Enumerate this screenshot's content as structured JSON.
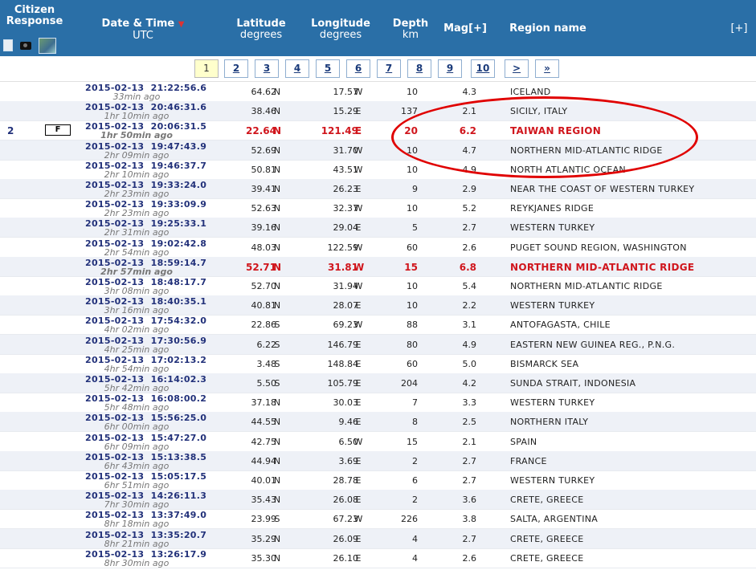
{
  "header": {
    "citizen_response": "Citizen Response",
    "date_time": "Date & Time",
    "date_time_unit": "UTC",
    "latitude": "Latitude",
    "latitude_unit": "degrees",
    "longitude": "Longitude",
    "longitude_unit": "degrees",
    "depth": "Depth",
    "depth_unit": "km",
    "mag": "Mag[+]",
    "region": "Region name",
    "expand": "[+]",
    "sort_indicator": "▼"
  },
  "pager": [
    "1",
    "2",
    "3",
    "4",
    "5",
    "6",
    "7",
    "8",
    "9",
    "10",
    ">",
    "»"
  ],
  "rows": [
    {
      "resp": "",
      "flag": "",
      "date": "2015-02-13",
      "time": "21:22:56.6",
      "ago": "33min ago",
      "lat": "64.62",
      "ns": "N",
      "lon": "17.57",
      "ew": "W",
      "depth": "10",
      "mag": "4.3",
      "region": "ICELAND",
      "hl": false
    },
    {
      "resp": "",
      "flag": "",
      "date": "2015-02-13",
      "time": "20:46:31.6",
      "ago": "1hr 10min ago",
      "lat": "38.46",
      "ns": "N",
      "lon": "15.29",
      "ew": "E",
      "depth": "137",
      "mag": "2.1",
      "region": "SICILY, ITALY",
      "hl": false
    },
    {
      "resp": "2",
      "flag": "F",
      "date": "2015-02-13",
      "time": "20:06:31.5",
      "ago": "1hr 50min ago",
      "lat": "22.64",
      "ns": "N",
      "lon": "121.49",
      "ew": "E",
      "depth": "20",
      "mag": "6.2",
      "region": "TAIWAN REGION",
      "hl": true
    },
    {
      "resp": "",
      "flag": "",
      "date": "2015-02-13",
      "time": "19:47:43.9",
      "ago": "2hr 09min ago",
      "lat": "52.69",
      "ns": "N",
      "lon": "31.70",
      "ew": "W",
      "depth": "10",
      "mag": "4.7",
      "region": "NORTHERN MID-ATLANTIC RIDGE",
      "hl": false
    },
    {
      "resp": "",
      "flag": "",
      "date": "2015-02-13",
      "time": "19:46:37.7",
      "ago": "2hr 10min ago",
      "lat": "50.81",
      "ns": "N",
      "lon": "43.51",
      "ew": "W",
      "depth": "10",
      "mag": "4.9",
      "region": "NORTH ATLANTIC OCEAN",
      "hl": false
    },
    {
      "resp": "",
      "flag": "",
      "date": "2015-02-13",
      "time": "19:33:24.0",
      "ago": "2hr 23min ago",
      "lat": "39.41",
      "ns": "N",
      "lon": "26.23",
      "ew": "E",
      "depth": "9",
      "mag": "2.9",
      "region": "NEAR THE COAST OF WESTERN TURKEY",
      "hl": false
    },
    {
      "resp": "",
      "flag": "",
      "date": "2015-02-13",
      "time": "19:33:09.9",
      "ago": "2hr 23min ago",
      "lat": "52.63",
      "ns": "N",
      "lon": "32.37",
      "ew": "W",
      "depth": "10",
      "mag": "5.2",
      "region": "REYKJANES RIDGE",
      "hl": false
    },
    {
      "resp": "",
      "flag": "",
      "date": "2015-02-13",
      "time": "19:25:33.1",
      "ago": "2hr 31min ago",
      "lat": "39.16",
      "ns": "N",
      "lon": "29.04",
      "ew": "E",
      "depth": "5",
      "mag": "2.7",
      "region": "WESTERN TURKEY",
      "hl": false
    },
    {
      "resp": "",
      "flag": "",
      "date": "2015-02-13",
      "time": "19:02:42.8",
      "ago": "2hr 54min ago",
      "lat": "48.03",
      "ns": "N",
      "lon": "122.59",
      "ew": "W",
      "depth": "60",
      "mag": "2.6",
      "region": "PUGET SOUND REGION, WASHINGTON",
      "hl": false
    },
    {
      "resp": "",
      "flag": "",
      "date": "2015-02-13",
      "time": "18:59:14.7",
      "ago": "2hr 57min ago",
      "lat": "52.71",
      "ns": "N",
      "lon": "31.81",
      "ew": "W",
      "depth": "15",
      "mag": "6.8",
      "region": "NORTHERN MID-ATLANTIC RIDGE",
      "hl": true
    },
    {
      "resp": "",
      "flag": "",
      "date": "2015-02-13",
      "time": "18:48:17.7",
      "ago": "3hr 08min ago",
      "lat": "52.70",
      "ns": "N",
      "lon": "31.94",
      "ew": "W",
      "depth": "10",
      "mag": "5.4",
      "region": "NORTHERN MID-ATLANTIC RIDGE",
      "hl": false
    },
    {
      "resp": "",
      "flag": "",
      "date": "2015-02-13",
      "time": "18:40:35.1",
      "ago": "3hr 16min ago",
      "lat": "40.81",
      "ns": "N",
      "lon": "28.07",
      "ew": "E",
      "depth": "10",
      "mag": "2.2",
      "region": "WESTERN TURKEY",
      "hl": false
    },
    {
      "resp": "",
      "flag": "",
      "date": "2015-02-13",
      "time": "17:54:32.0",
      "ago": "4hr 02min ago",
      "lat": "22.86",
      "ns": "S",
      "lon": "69.23",
      "ew": "W",
      "depth": "88",
      "mag": "3.1",
      "region": "ANTOFAGASTA, CHILE",
      "hl": false
    },
    {
      "resp": "",
      "flag": "",
      "date": "2015-02-13",
      "time": "17:30:56.9",
      "ago": "4hr 25min ago",
      "lat": "6.22",
      "ns": "S",
      "lon": "146.79",
      "ew": "E",
      "depth": "80",
      "mag": "4.9",
      "region": "EASTERN NEW GUINEA REG., P.N.G.",
      "hl": false
    },
    {
      "resp": "",
      "flag": "",
      "date": "2015-02-13",
      "time": "17:02:13.2",
      "ago": "4hr 54min ago",
      "lat": "3.48",
      "ns": "S",
      "lon": "148.84",
      "ew": "E",
      "depth": "60",
      "mag": "5.0",
      "region": "BISMARCK SEA",
      "hl": false
    },
    {
      "resp": "",
      "flag": "",
      "date": "2015-02-13",
      "time": "16:14:02.3",
      "ago": "5hr 42min ago",
      "lat": "5.50",
      "ns": "S",
      "lon": "105.79",
      "ew": "E",
      "depth": "204",
      "mag": "4.2",
      "region": "SUNDA STRAIT, INDONESIA",
      "hl": false
    },
    {
      "resp": "",
      "flag": "",
      "date": "2015-02-13",
      "time": "16:08:00.2",
      "ago": "5hr 48min ago",
      "lat": "37.18",
      "ns": "N",
      "lon": "30.03",
      "ew": "E",
      "depth": "7",
      "mag": "3.3",
      "region": "WESTERN TURKEY",
      "hl": false
    },
    {
      "resp": "",
      "flag": "",
      "date": "2015-02-13",
      "time": "15:56:25.0",
      "ago": "6hr 00min ago",
      "lat": "44.55",
      "ns": "N",
      "lon": "9.46",
      "ew": "E",
      "depth": "8",
      "mag": "2.5",
      "region": "NORTHERN ITALY",
      "hl": false
    },
    {
      "resp": "",
      "flag": "",
      "date": "2015-02-13",
      "time": "15:47:27.0",
      "ago": "6hr 09min ago",
      "lat": "42.75",
      "ns": "N",
      "lon": "6.50",
      "ew": "W",
      "depth": "15",
      "mag": "2.1",
      "region": "SPAIN",
      "hl": false
    },
    {
      "resp": "",
      "flag": "",
      "date": "2015-02-13",
      "time": "15:13:38.5",
      "ago": "6hr 43min ago",
      "lat": "44.94",
      "ns": "N",
      "lon": "3.69",
      "ew": "E",
      "depth": "2",
      "mag": "2.7",
      "region": "FRANCE",
      "hl": false
    },
    {
      "resp": "",
      "flag": "",
      "date": "2015-02-13",
      "time": "15:05:17.5",
      "ago": "6hr 51min ago",
      "lat": "40.01",
      "ns": "N",
      "lon": "28.78",
      "ew": "E",
      "depth": "6",
      "mag": "2.7",
      "region": "WESTERN TURKEY",
      "hl": false
    },
    {
      "resp": "",
      "flag": "",
      "date": "2015-02-13",
      "time": "14:26:11.3",
      "ago": "7hr 30min ago",
      "lat": "35.43",
      "ns": "N",
      "lon": "26.08",
      "ew": "E",
      "depth": "2",
      "mag": "3.6",
      "region": "CRETE, GREECE",
      "hl": false
    },
    {
      "resp": "",
      "flag": "",
      "date": "2015-02-13",
      "time": "13:37:49.0",
      "ago": "8hr 18min ago",
      "lat": "23.99",
      "ns": "S",
      "lon": "67.23",
      "ew": "W",
      "depth": "226",
      "mag": "3.8",
      "region": "SALTA, ARGENTINA",
      "hl": false
    },
    {
      "resp": "",
      "flag": "",
      "date": "2015-02-13",
      "time": "13:35:20.7",
      "ago": "8hr 21min ago",
      "lat": "35.29",
      "ns": "N",
      "lon": "26.09",
      "ew": "E",
      "depth": "4",
      "mag": "2.7",
      "region": "CRETE, GREECE",
      "hl": false
    },
    {
      "resp": "",
      "flag": "",
      "date": "2015-02-13",
      "time": "13:26:17.9",
      "ago": "8hr 30min ago",
      "lat": "35.30",
      "ns": "N",
      "lon": "26.10",
      "ew": "E",
      "depth": "4",
      "mag": "2.6",
      "region": "CRETE, GREECE",
      "hl": false
    }
  ]
}
